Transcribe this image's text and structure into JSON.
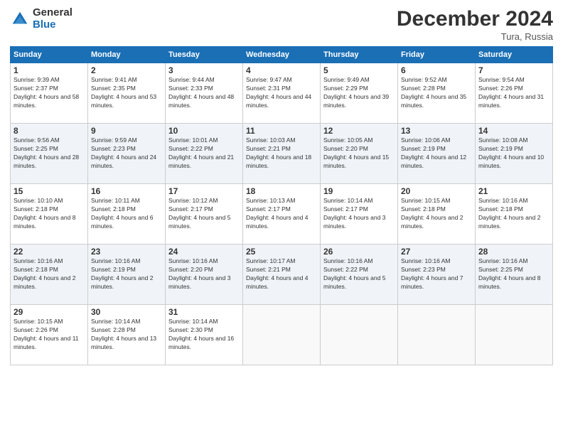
{
  "logo": {
    "general": "General",
    "blue": "Blue"
  },
  "header": {
    "month": "December 2024",
    "location": "Tura, Russia"
  },
  "weekdays": [
    "Sunday",
    "Monday",
    "Tuesday",
    "Wednesday",
    "Thursday",
    "Friday",
    "Saturday"
  ],
  "weeks": [
    [
      {
        "day": 1,
        "sunrise": "9:39 AM",
        "sunset": "2:37 PM",
        "daylight": "4 hours and 58 minutes."
      },
      {
        "day": 2,
        "sunrise": "9:41 AM",
        "sunset": "2:35 PM",
        "daylight": "4 hours and 53 minutes."
      },
      {
        "day": 3,
        "sunrise": "9:44 AM",
        "sunset": "2:33 PM",
        "daylight": "4 hours and 48 minutes."
      },
      {
        "day": 4,
        "sunrise": "9:47 AM",
        "sunset": "2:31 PM",
        "daylight": "4 hours and 44 minutes."
      },
      {
        "day": 5,
        "sunrise": "9:49 AM",
        "sunset": "2:29 PM",
        "daylight": "4 hours and 39 minutes."
      },
      {
        "day": 6,
        "sunrise": "9:52 AM",
        "sunset": "2:28 PM",
        "daylight": "4 hours and 35 minutes."
      },
      {
        "day": 7,
        "sunrise": "9:54 AM",
        "sunset": "2:26 PM",
        "daylight": "4 hours and 31 minutes."
      }
    ],
    [
      {
        "day": 8,
        "sunrise": "9:56 AM",
        "sunset": "2:25 PM",
        "daylight": "4 hours and 28 minutes."
      },
      {
        "day": 9,
        "sunrise": "9:59 AM",
        "sunset": "2:23 PM",
        "daylight": "4 hours and 24 minutes."
      },
      {
        "day": 10,
        "sunrise": "10:01 AM",
        "sunset": "2:22 PM",
        "daylight": "4 hours and 21 minutes."
      },
      {
        "day": 11,
        "sunrise": "10:03 AM",
        "sunset": "2:21 PM",
        "daylight": "4 hours and 18 minutes."
      },
      {
        "day": 12,
        "sunrise": "10:05 AM",
        "sunset": "2:20 PM",
        "daylight": "4 hours and 15 minutes."
      },
      {
        "day": 13,
        "sunrise": "10:06 AM",
        "sunset": "2:19 PM",
        "daylight": "4 hours and 12 minutes."
      },
      {
        "day": 14,
        "sunrise": "10:08 AM",
        "sunset": "2:19 PM",
        "daylight": "4 hours and 10 minutes."
      }
    ],
    [
      {
        "day": 15,
        "sunrise": "10:10 AM",
        "sunset": "2:18 PM",
        "daylight": "4 hours and 8 minutes."
      },
      {
        "day": 16,
        "sunrise": "10:11 AM",
        "sunset": "2:18 PM",
        "daylight": "4 hours and 6 minutes."
      },
      {
        "day": 17,
        "sunrise": "10:12 AM",
        "sunset": "2:17 PM",
        "daylight": "4 hours and 5 minutes."
      },
      {
        "day": 18,
        "sunrise": "10:13 AM",
        "sunset": "2:17 PM",
        "daylight": "4 hours and 4 minutes."
      },
      {
        "day": 19,
        "sunrise": "10:14 AM",
        "sunset": "2:17 PM",
        "daylight": "4 hours and 3 minutes."
      },
      {
        "day": 20,
        "sunrise": "10:15 AM",
        "sunset": "2:18 PM",
        "daylight": "4 hours and 2 minutes."
      },
      {
        "day": 21,
        "sunrise": "10:16 AM",
        "sunset": "2:18 PM",
        "daylight": "4 hours and 2 minutes."
      }
    ],
    [
      {
        "day": 22,
        "sunrise": "10:16 AM",
        "sunset": "2:18 PM",
        "daylight": "4 hours and 2 minutes."
      },
      {
        "day": 23,
        "sunrise": "10:16 AM",
        "sunset": "2:19 PM",
        "daylight": "4 hours and 2 minutes."
      },
      {
        "day": 24,
        "sunrise": "10:16 AM",
        "sunset": "2:20 PM",
        "daylight": "4 hours and 3 minutes."
      },
      {
        "day": 25,
        "sunrise": "10:17 AM",
        "sunset": "2:21 PM",
        "daylight": "4 hours and 4 minutes."
      },
      {
        "day": 26,
        "sunrise": "10:16 AM",
        "sunset": "2:22 PM",
        "daylight": "4 hours and 5 minutes."
      },
      {
        "day": 27,
        "sunrise": "10:16 AM",
        "sunset": "2:23 PM",
        "daylight": "4 hours and 7 minutes."
      },
      {
        "day": 28,
        "sunrise": "10:16 AM",
        "sunset": "2:25 PM",
        "daylight": "4 hours and 8 minutes."
      }
    ],
    [
      {
        "day": 29,
        "sunrise": "10:15 AM",
        "sunset": "2:26 PM",
        "daylight": "4 hours and 11 minutes."
      },
      {
        "day": 30,
        "sunrise": "10:14 AM",
        "sunset": "2:28 PM",
        "daylight": "4 hours and 13 minutes."
      },
      {
        "day": 31,
        "sunrise": "10:14 AM",
        "sunset": "2:30 PM",
        "daylight": "4 hours and 16 minutes."
      },
      null,
      null,
      null,
      null
    ]
  ]
}
